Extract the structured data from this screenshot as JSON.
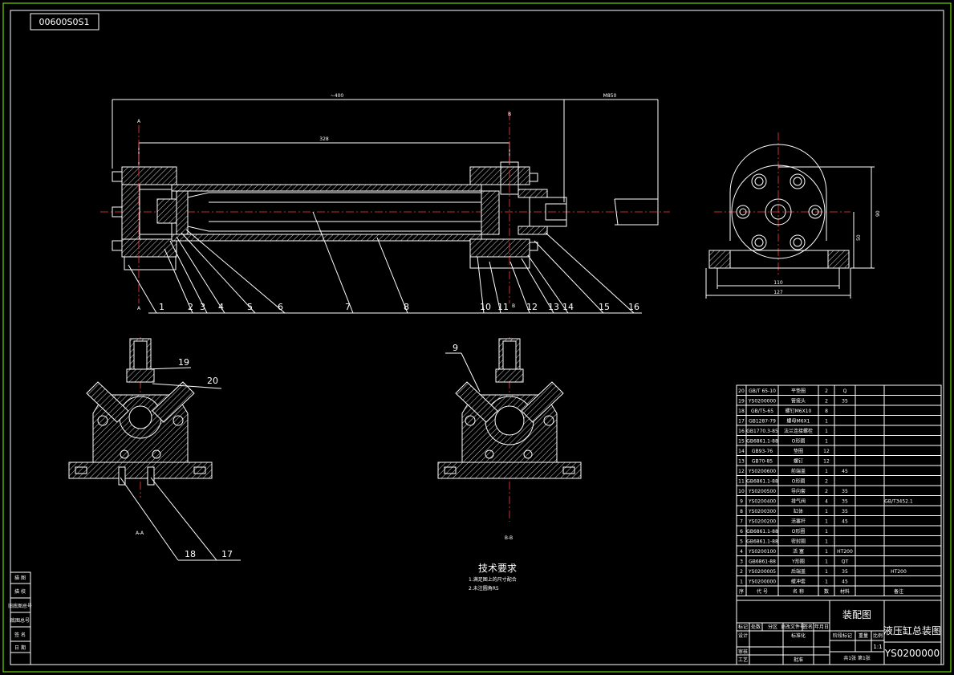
{
  "drawing_number": "00600S0S1",
  "balloons": [
    "1",
    "2",
    "3",
    "4",
    "5",
    "6",
    "7",
    "8",
    "10",
    "11",
    "12",
    "13",
    "14",
    "15",
    "16"
  ],
  "section_labels": {
    "a_top": "A",
    "a_bottom": "A",
    "b_top": "B",
    "b_bottom": "B"
  },
  "view_labels": {
    "aa": "A-A",
    "bb": "B-B"
  },
  "dims": {
    "overall": "~400",
    "stroke": "328",
    "rod": "M850",
    "width1": "110",
    "width2": "127",
    "h1": "50",
    "h2": "90"
  },
  "callouts_aa": [
    "19",
    "20",
    "18",
    "17"
  ],
  "callouts_bb": [
    "9"
  ],
  "technical_requirements": {
    "title": "技术要求",
    "items": [
      "1.满足图上的尺寸配合",
      "2.未注圆角R5"
    ]
  },
  "left_strip": [
    "描 图",
    "描 校",
    "旧底图总号",
    "底图总号",
    "签 名",
    "日 期"
  ],
  "bom": {
    "rows": [
      {
        "no": "20",
        "code": "GB/T 65-10",
        "name": "平垫圈",
        "qty": "2",
        "mat": "Q",
        "note": ""
      },
      {
        "no": "19",
        "code": "YS0200000",
        "name": "管接头",
        "qty": "2",
        "mat": "35",
        "note": ""
      },
      {
        "no": "18",
        "code": "GB/T5-65",
        "name": "螺钉M6X10",
        "qty": "8",
        "mat": "",
        "note": ""
      },
      {
        "no": "17",
        "code": "GB1287-79",
        "name": "螺母M6X1",
        "qty": "1",
        "mat": "",
        "note": ""
      },
      {
        "no": "16",
        "code": "GB1770.3-85",
        "name": "法兰连接螺栓",
        "qty": "1",
        "mat": "",
        "note": ""
      },
      {
        "no": "15",
        "code": "GB6861.1-88",
        "name": "O形圈",
        "qty": "1",
        "mat": "",
        "note": ""
      },
      {
        "no": "14",
        "code": "GB93-76",
        "name": "垫圈",
        "qty": "12",
        "mat": "",
        "note": ""
      },
      {
        "no": "13",
        "code": "GB70-85",
        "name": "螺钉",
        "qty": "12",
        "mat": "",
        "note": ""
      },
      {
        "no": "12",
        "code": "YS0200600",
        "name": "前端盖",
        "qty": "1",
        "mat": "45",
        "note": ""
      },
      {
        "no": "11",
        "code": "GB6861.1-88",
        "name": "O形圈",
        "qty": "2",
        "mat": "",
        "note": ""
      },
      {
        "no": "10",
        "code": "YS0200500",
        "name": "导向套",
        "qty": "2",
        "mat": "35",
        "note": ""
      },
      {
        "no": "9",
        "code": "YS0200400",
        "name": "排气阀",
        "qty": "4",
        "mat": "35",
        "note": "GB/T3452.1"
      },
      {
        "no": "8",
        "code": "YS0200300",
        "name": "缸体",
        "qty": "1",
        "mat": "35",
        "note": ""
      },
      {
        "no": "7",
        "code": "YS0200200",
        "name": "活塞杆",
        "qty": "1",
        "mat": "45",
        "note": ""
      },
      {
        "no": "6",
        "code": "GB6861.1-88",
        "name": "O形圈",
        "qty": "1",
        "mat": "",
        "note": ""
      },
      {
        "no": "5",
        "code": "GB6861.1-88",
        "name": "密封圈",
        "qty": "1",
        "mat": "",
        "note": ""
      },
      {
        "no": "4",
        "code": "YS0200100",
        "name": "活 塞",
        "qty": "1",
        "mat": "HT200",
        "note": ""
      },
      {
        "no": "3",
        "code": "GB6861-88",
        "name": "Y形圈",
        "qty": "1",
        "mat": "QT",
        "note": ""
      },
      {
        "no": "2",
        "code": "YS0200005",
        "name": "后端盖",
        "qty": "1",
        "mat": "35",
        "note": "HT200"
      },
      {
        "no": "1",
        "code": "YS0200000",
        "name": "缓冲套",
        "qty": "1",
        "mat": "45",
        "note": ""
      }
    ],
    "header": {
      "no": "序",
      "code": "代 号",
      "name": "名 称",
      "qty": "数",
      "mat": "材料",
      "note": "备注"
    }
  },
  "title_block": {
    "type": "装配图",
    "title": "液压缸总装图",
    "code": "YS0200000",
    "scale": "1:1",
    "sheet": "共1张 第1张",
    "cells": [
      "标记",
      "处数",
      "分区",
      "更改文件号",
      "签名",
      "年月日",
      "设计",
      "标准化",
      "审核",
      "工艺",
      "批准",
      "阶段标记",
      "重量",
      "比例"
    ]
  }
}
